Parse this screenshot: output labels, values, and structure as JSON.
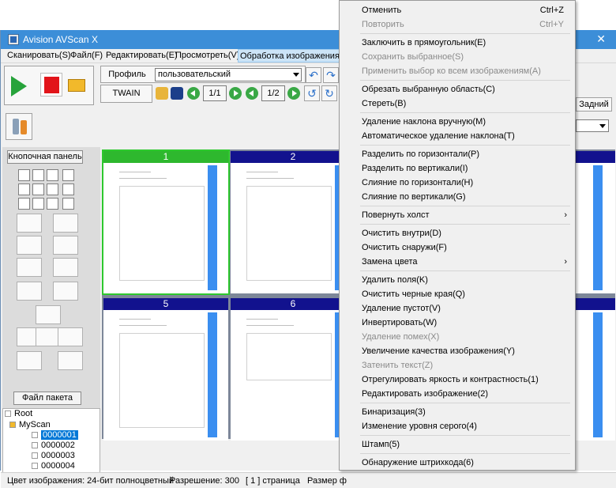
{
  "window": {
    "title": "Avision AVScan X"
  },
  "menubar": [
    "Сканировать(S)",
    "Файл(F)",
    "Редактировать(E)",
    "Просмотреть(V)",
    "Обработка изображения(I)"
  ],
  "toolbar": {
    "profile_label": "Профиль",
    "profile_value": "пользовательский",
    "twain_label": "TWAIN",
    "page_a": "1/1",
    "page_b": "1/2",
    "right_button": "Задний"
  },
  "left_panel": {
    "title": "Кнопочная панель",
    "package_button": "Файл пакета"
  },
  "tree": {
    "root": "Root",
    "folder": "MyScan",
    "items": [
      "0000001",
      "0000002",
      "0000003",
      "0000004"
    ]
  },
  "thumbnails": [
    {
      "number": "1"
    },
    {
      "number": "2"
    },
    {
      "number": "5"
    },
    {
      "number": "6"
    }
  ],
  "status": {
    "color": "Цвет изображения: 24-бит полноцветный",
    "resolution": "Разрешение: 300",
    "pages": "[ 1 ] страница",
    "size": "Размер ф"
  },
  "context_menu": [
    {
      "label": "Отменить",
      "shortcut": "Ctrl+Z",
      "disabled": false
    },
    {
      "label": "Повторить",
      "shortcut": "Ctrl+Y",
      "disabled": true
    },
    {
      "label": "Заключить в прямоугольник(E)",
      "disabled": false
    },
    {
      "label": "Сохранить выбранное(S)",
      "disabled": true
    },
    {
      "label": "Применить выбор ко всем изображениям(A)",
      "disabled": true
    },
    {
      "label": "Обрезать выбранную область(C)",
      "disabled": false
    },
    {
      "label": "Стереть(B)",
      "disabled": false
    },
    {
      "label": "Удаление наклона вручную(M)",
      "disabled": false
    },
    {
      "label": "Автоматическое удаление наклона(T)",
      "disabled": false
    },
    {
      "label": "Разделить по горизонтали(P)",
      "disabled": false
    },
    {
      "label": "Разделить по вертикали(I)",
      "disabled": false
    },
    {
      "label": "Слияние по горизонтали(H)",
      "disabled": false
    },
    {
      "label": "Слияние по вертикали(G)",
      "disabled": false
    },
    {
      "label": "Повернуть холст",
      "disabled": false
    },
    {
      "label": "Очистить внутри(D)",
      "disabled": false
    },
    {
      "label": "Очистить снаружи(F)",
      "disabled": false
    },
    {
      "label": "Замена цвета",
      "disabled": false
    },
    {
      "label": "Удалить поля(K)",
      "disabled": false
    },
    {
      "label": "Очистить черные края(Q)",
      "disabled": false
    },
    {
      "label": "Удаление пустот(V)",
      "disabled": false
    },
    {
      "label": "Инвертировать(W)",
      "disabled": false
    },
    {
      "label": "Удаление помех(X)",
      "disabled": true
    },
    {
      "label": "Увеличение качества изображения(Y)",
      "disabled": false
    },
    {
      "label": "Затенить текст(Z)",
      "disabled": true
    },
    {
      "label": "Отрегулировать яркость и контрастность(1)",
      "disabled": false
    },
    {
      "label": "Редактировать изображение(2)",
      "disabled": false
    },
    {
      "label": "Бинаризация(3)",
      "disabled": false
    },
    {
      "label": "Изменение уровня серого(4)",
      "disabled": false
    },
    {
      "label": "Штамп(5)",
      "disabled": false
    },
    {
      "label": "Обнаружение штрихкода(6)",
      "disabled": false
    }
  ],
  "submenu_arrow": "›"
}
